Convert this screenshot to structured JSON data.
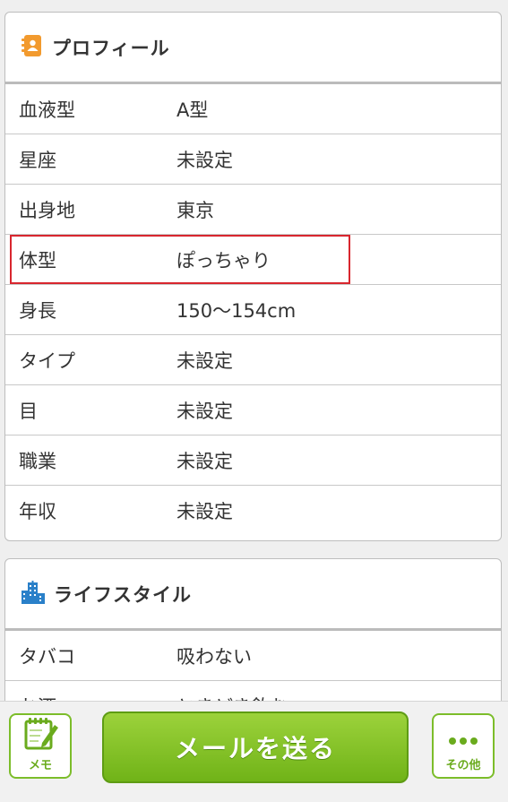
{
  "profile": {
    "title": "プロフィール",
    "rows": [
      {
        "label": "血液型",
        "value": "A型"
      },
      {
        "label": "星座",
        "value": "未設定"
      },
      {
        "label": "出身地",
        "value": "東京"
      },
      {
        "label": "体型",
        "value": "ぽっちゃり"
      },
      {
        "label": "身長",
        "value": "150〜154cm"
      },
      {
        "label": "タイプ",
        "value": "未設定"
      },
      {
        "label": "目",
        "value": "未設定"
      },
      {
        "label": "職業",
        "value": "未設定"
      },
      {
        "label": "年収",
        "value": "未設定"
      }
    ]
  },
  "lifestyle": {
    "title": "ライフスタイル",
    "rows": [
      {
        "label": "タバコ",
        "value": "吸わない"
      },
      {
        "label": "お酒",
        "value": "ときどき飲む"
      }
    ]
  },
  "bottom_bar": {
    "memo_label": "メモ",
    "send_label": "メールを送る",
    "other_label": "その他"
  },
  "icons": {
    "profile": "address-book-icon",
    "lifestyle": "buildings-icon",
    "memo": "notepad-pencil-icon",
    "other": "more-dots-icon"
  },
  "colors": {
    "accent_green": "#7cbd2a",
    "highlight_red": "#d8262e",
    "profile_icon": "#f29a2e",
    "lifestyle_icon": "#2a80c9"
  }
}
